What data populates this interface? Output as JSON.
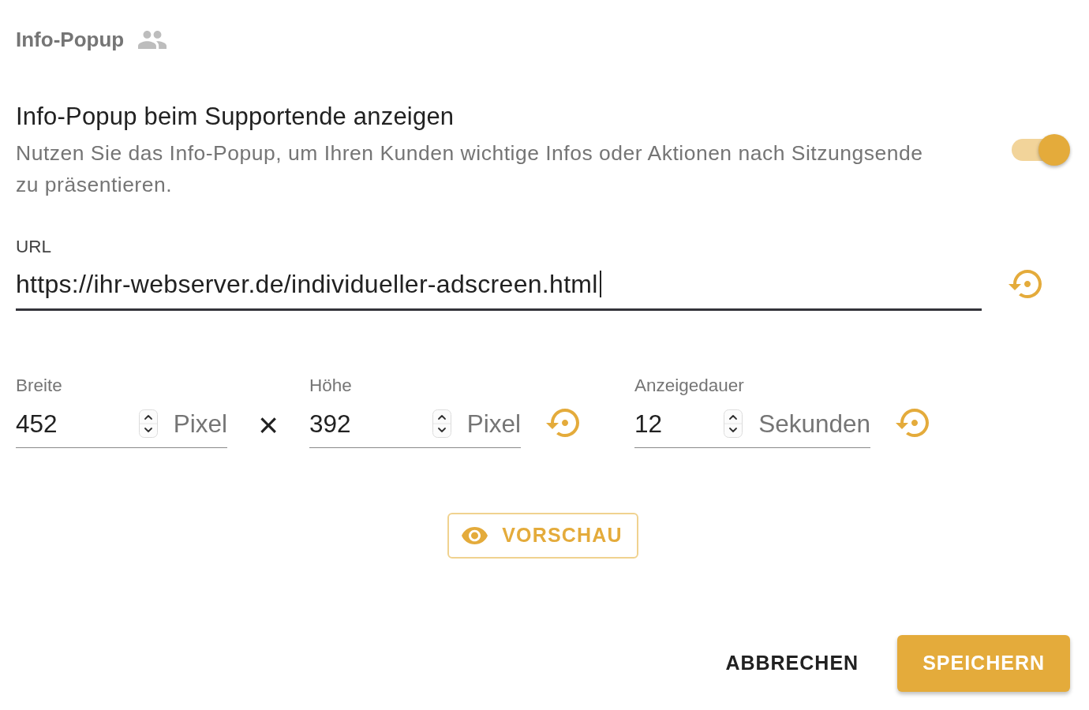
{
  "header": {
    "title": "Info-Popup"
  },
  "popup_setting": {
    "title": "Info-Popup beim Supportende anzeigen",
    "description": "Nutzen Sie das Info-Popup, um Ihren Kunden wichtige Infos oder Aktionen nach Sitzungsende zu präsentieren.",
    "on": true
  },
  "url_field": {
    "label": "URL",
    "value": "https://ihr-webserver.de/individueller-adscreen.html",
    "focused": true
  },
  "size": {
    "fields": [
      {
        "label": "Breite",
        "value": "452",
        "unit": "Pixel"
      },
      {
        "label": "Höhe",
        "value": "392",
        "unit": "Pixel"
      }
    ],
    "separator": "×"
  },
  "duration_field": {
    "label": "Anzeigedauer",
    "value": "12",
    "unit": "Sekunden"
  },
  "preview_button": {
    "label": "VORSCHAU"
  },
  "actions": [
    {
      "label": "ABBRECHEN",
      "kind": "text"
    },
    {
      "label": "SPEICHERN",
      "kind": "primary"
    }
  ]
}
